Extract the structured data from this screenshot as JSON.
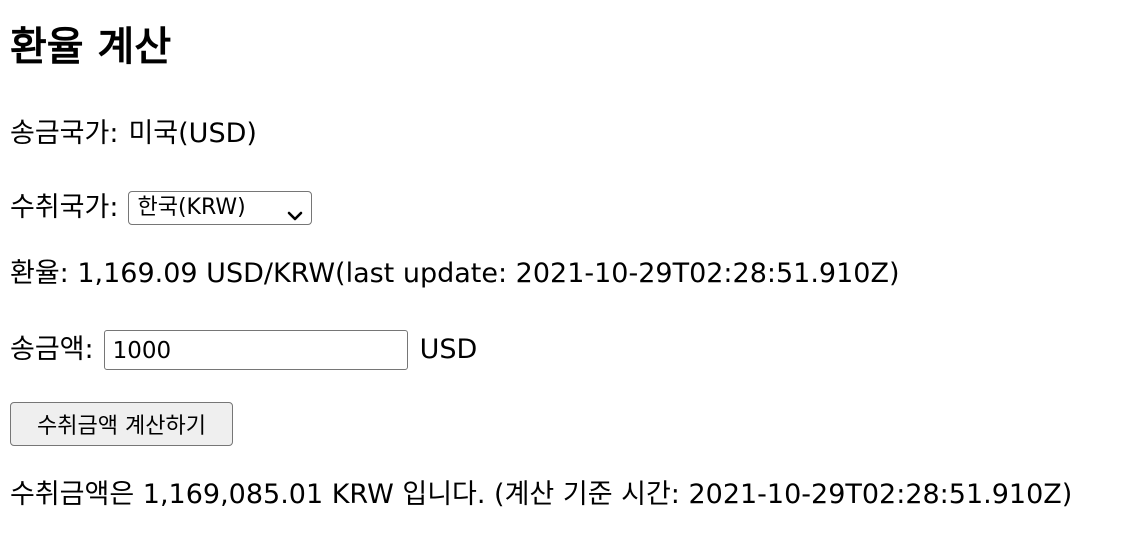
{
  "page": {
    "title": "환율 계산"
  },
  "sender": {
    "label": "송금국가:",
    "value": "미국(USD)"
  },
  "receiver": {
    "label": "수취국가:",
    "selected": "한국(KRW)"
  },
  "rate": {
    "text": "환율: 1,169.09 USD/KRW(last update: 2021-10-29T02:28:51.910Z)"
  },
  "amount": {
    "label": "송금액:",
    "value": "1000",
    "unit": "USD"
  },
  "actions": {
    "calculate_label": "수취금액 계산하기"
  },
  "result": {
    "text": "수취금액은 1,169,085.01 KRW 입니다. (계산 기준 시간: 2021-10-29T02:28:51.910Z)"
  }
}
